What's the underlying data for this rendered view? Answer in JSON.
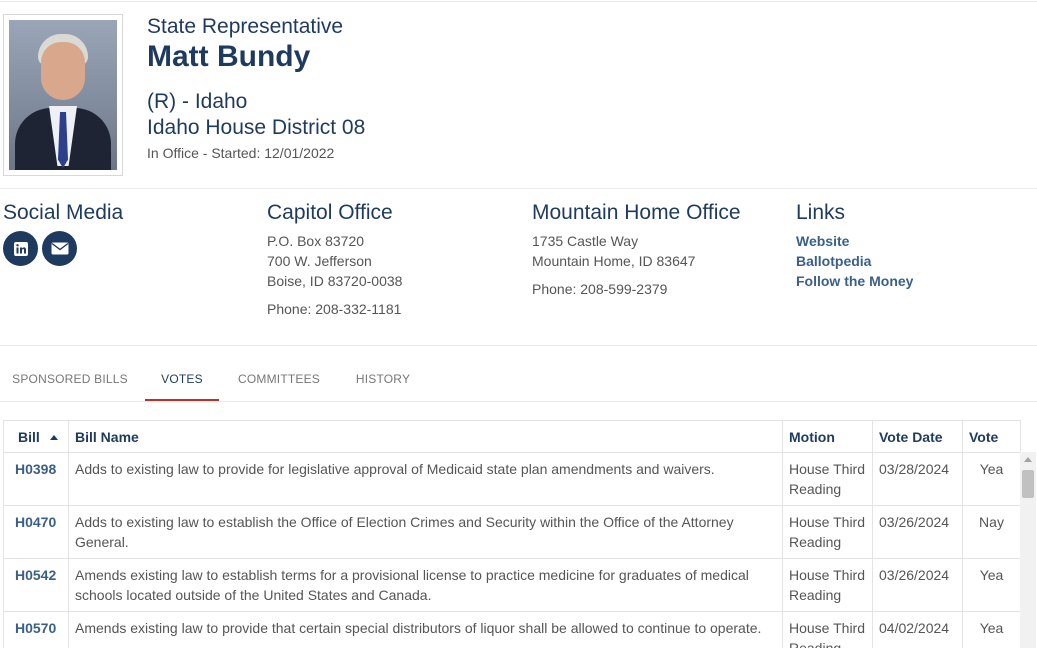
{
  "profile": {
    "title": "State Representative",
    "name": "Matt Bundy",
    "party": "(R) - Idaho",
    "district": "Idaho House District 08",
    "in_office": "In Office - Started: 12/01/2022"
  },
  "social": {
    "heading": "Social Media",
    "icons": [
      "linkedin-icon",
      "email-icon"
    ]
  },
  "capitol": {
    "heading": "Capitol Office",
    "line1": "P.O. Box 83720",
    "line2": "700 W. Jefferson",
    "line3": "Boise, ID 83720-0038",
    "phone": "Phone: 208-332-1181"
  },
  "district_office": {
    "heading": "Mountain Home Office",
    "line1": "1735 Castle Way",
    "line2": "Mountain Home, ID 83647",
    "phone": "Phone: 208-599-2379"
  },
  "links": {
    "heading": "Links",
    "items": [
      "Website",
      "Ballotpedia",
      "Follow the Money"
    ]
  },
  "tabs": [
    "SPONSORED BILLS",
    "VOTES",
    "COMMITTEES",
    "HISTORY"
  ],
  "active_tab": "VOTES",
  "colors": {
    "primary": "#1f3a5f",
    "link": "#3a5f8a",
    "tab_underline": "#b83230"
  },
  "table": {
    "headers": [
      "Bill",
      "Bill Name",
      "Motion",
      "Vote Date",
      "Vote"
    ],
    "rows": [
      {
        "bill": "H0398",
        "name": "Adds to existing law to provide for legislative approval of Medicaid state plan amendments and waivers.",
        "motion": "House Third Reading",
        "date": "03/28/2024",
        "vote": "Yea"
      },
      {
        "bill": "H0470",
        "name": "Adds to existing law to establish the Office of Election Crimes and Security within the Office of the Attorney General.",
        "motion": "House Third Reading",
        "date": "03/26/2024",
        "vote": "Nay"
      },
      {
        "bill": "H0542",
        "name": "Amends existing law to establish terms for a provisional license to practice medicine for graduates of medical schools located outside of the United States and Canada.",
        "motion": "House Third Reading",
        "date": "03/26/2024",
        "vote": "Yea"
      },
      {
        "bill": "H0570",
        "name": "Amends existing law to provide that certain special distributors of liquor shall be allowed to continue to operate.",
        "motion": "House Third Reading",
        "date": "04/02/2024",
        "vote": "Yea"
      }
    ]
  }
}
